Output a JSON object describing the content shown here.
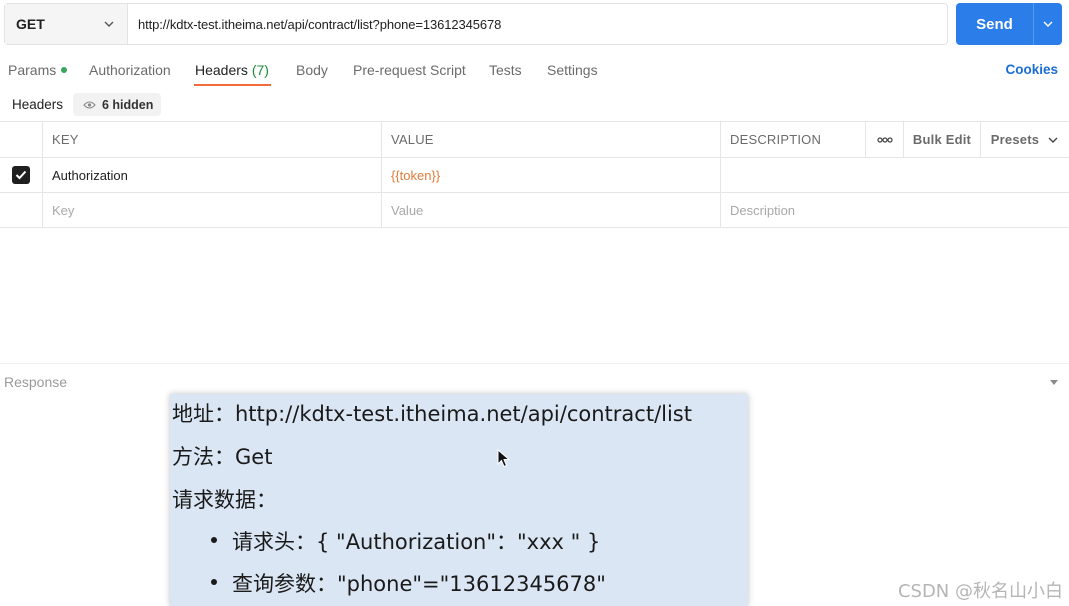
{
  "request": {
    "method": "GET",
    "url": "http://kdtx-test.itheima.net/api/contract/list?phone=13612345678",
    "send_label": "Send"
  },
  "tabs": [
    {
      "label": "Params"
    },
    {
      "label": "Authorization"
    },
    {
      "label": "Headers",
      "count": "(7)"
    },
    {
      "label": "Body"
    },
    {
      "label": "Pre-request Script"
    },
    {
      "label": "Tests"
    },
    {
      "label": "Settings"
    }
  ],
  "cookies_label": "Cookies",
  "headers_bar": {
    "title": "Headers",
    "hidden_label": "6 hidden"
  },
  "table": {
    "columns": [
      "KEY",
      "VALUE",
      "DESCRIPTION"
    ],
    "bulk_edit": "Bulk Edit",
    "presets": "Presets",
    "rows": [
      {
        "key": "Authorization",
        "value": "{{token}}",
        "description": ""
      }
    ],
    "placeholders": {
      "key": "Key",
      "value": "Value",
      "description": "Description"
    }
  },
  "response_label": "Response",
  "note": {
    "address": "地址：http://kdtx-test.itheima.net/api/contract/list",
    "method": "方法：Get",
    "request_data": "请求数据：",
    "bullets": [
      "请求头：{ \"Authorization\"：\"xxx \" }",
      "查询参数：\"phone\"=\"13612345678\""
    ]
  },
  "watermark": "CSDN @秋名山小白",
  "colors": {
    "send": "#2b7de9",
    "tab_underline": "#f26b3a",
    "token": "#e07b39",
    "link": "#1a6dd6",
    "note_bg": "#dbe6f4"
  }
}
